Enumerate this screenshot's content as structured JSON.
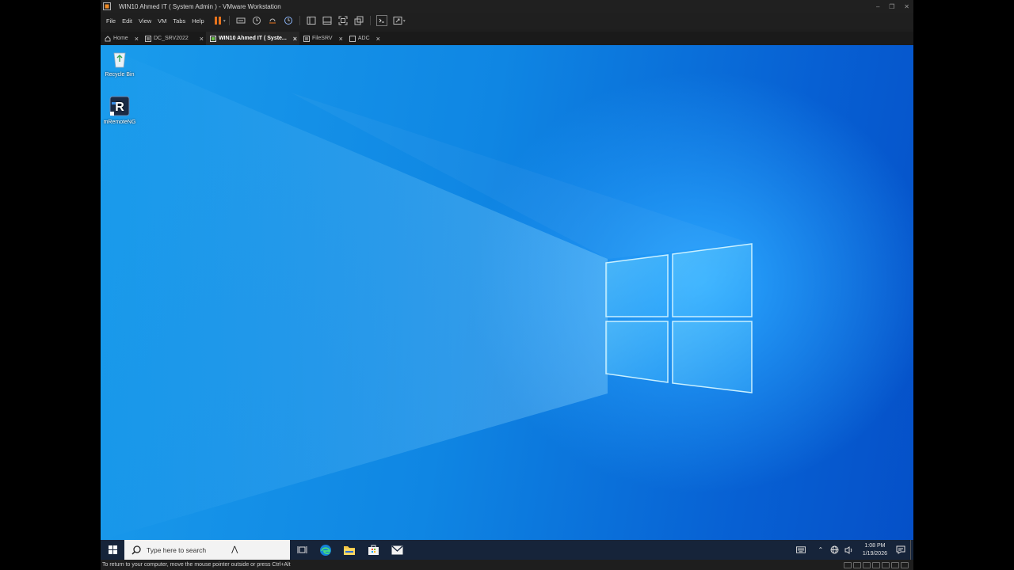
{
  "window": {
    "title": "WIN10 Ahmed IT ( System Admin ) - VMware Workstation"
  },
  "menu": [
    "File",
    "Edit",
    "View",
    "VM",
    "Tabs",
    "Help"
  ],
  "tabs": [
    {
      "label": "Home",
      "icon": "home-icon",
      "active": false
    },
    {
      "label": "DC_SRV2022",
      "icon": "vm-icon",
      "active": false
    },
    {
      "label": "WIN10 Ahmed IT ( Syste...",
      "icon": "vm-icon",
      "active": true
    },
    {
      "label": "FileSRV",
      "icon": "vm-icon",
      "active": false
    },
    {
      "label": "ADC",
      "icon": "vm-icon",
      "active": false
    }
  ],
  "desktop_icons": [
    {
      "label": "Recycle Bin",
      "icon": "recycle-bin-icon"
    },
    {
      "label": "mRemoteNG",
      "icon": "mremoteng-icon"
    }
  ],
  "taskbar": {
    "search_placeholder": "Type here to search",
    "time": "1:08 PM",
    "date": "1/19/2026"
  },
  "statusbar": {
    "message": "To return to your computer, move the mouse pointer outside or press Ctrl+Alt"
  },
  "colors": {
    "desktop_blue": "#0f86e3",
    "pause_orange": "#e8731c"
  }
}
